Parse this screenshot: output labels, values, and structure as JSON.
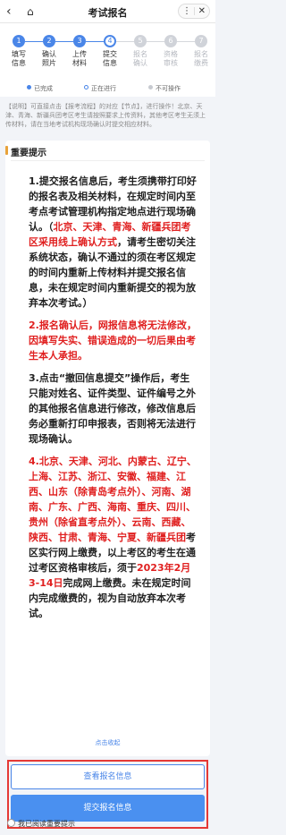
{
  "header": {
    "title": "考试报名"
  },
  "steps": [
    {
      "number": "1",
      "label_l1": "填写",
      "label_l2": "信息"
    },
    {
      "number": "2",
      "label_l1": "确认",
      "label_l2": "照片"
    },
    {
      "number": "3",
      "label_l1": "上传",
      "label_l2": "材料"
    },
    {
      "number": "4",
      "label_l1": "提交",
      "label_l2": "信息"
    },
    {
      "number": "5",
      "label_l1": "报名",
      "label_l2": "确认"
    },
    {
      "number": "6",
      "label_l1": "资格",
      "label_l2": "审核"
    },
    {
      "number": "7",
      "label_l1": "报名",
      "label_l2": "缴费"
    }
  ],
  "legend": {
    "done": "已完成",
    "current": "正在进行",
    "disabled": "不可操作"
  },
  "notice": "【说明】可直接点击【报考流程】的对应【节点】，进行操作！北京、天津、青海、新疆兵团考区考生请按照要求上传资料，其他考区考生无须上传材料，请在当地考试机构现场确认时提交相应材料。",
  "important": {
    "title": "重要提示",
    "p1_a": "1.提交报名信息后，考生须携带打印好的报名表及相关材料，在规定时间内至考点考试管理机构指定地点进行现场确认。（",
    "p1_red": "北京、天津、青海、新疆兵团考区采用线上确认方式",
    "p1_b": "，请考生密切关注系统状态，确认不通过的须在考区规定的时间内重新上传材料并提交报名信息，未在规定时间内重新提交的视为放弃本次考试。）",
    "p2_red": "2.报名确认后，网报信息将无法修改，因填写失实、错误造成的一切后果由考生本人承担。",
    "p3": "3.点击“撤回信息提交”操作后，考生只能对姓名、证件类型、证件编号之外的其他报名信息进行修改，修改信息后务必重新打印申报表，否则将无法进行现场确认。",
    "p4_red1": "4.北京、天津、河北、内蒙古、辽宁、上海、江苏、浙江、安徽、福建、江西、山东（除青岛考点外）、河南、湖南、广东、广西、海南、重庆、四川、贵州（除省直考点外）、云南、西藏、陕西、甘肃、青海、宁夏、新疆兵团",
    "p4_a": "考区实行网上缴费，以上考区的考生在通过考区资格审核后，须于",
    "p4_red2": "2023年2月3-14日",
    "p4_b": "完成网上缴费。未在规定时间内完成缴费的，视为自动放弃本次考试。",
    "collapse": "点击收起"
  },
  "buttons": {
    "view": "查看报名信息",
    "submit": "提交报名信息"
  },
  "agree": "我已阅读重要提示"
}
